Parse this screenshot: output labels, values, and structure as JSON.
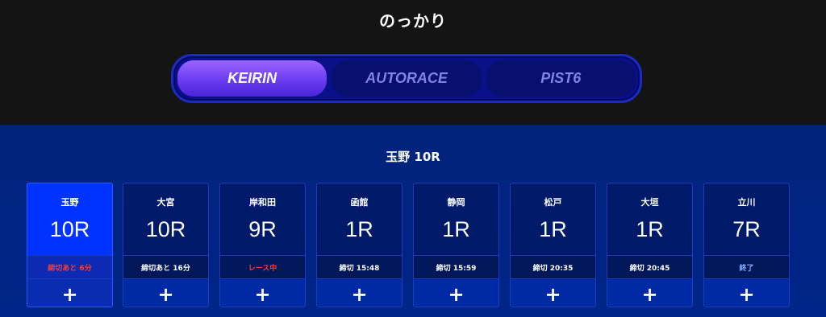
{
  "header": {
    "title": "のっかり"
  },
  "tabs": [
    {
      "label": "KEIRIN",
      "active": true
    },
    {
      "label": "AUTORACE",
      "active": false
    },
    {
      "label": "PIST6",
      "active": false
    }
  ],
  "race_title": "玉野 10R",
  "cards": [
    {
      "venue": "玉野",
      "race": "10R",
      "status": "締切あと 6分",
      "status_color": "red",
      "add": "+"
    },
    {
      "venue": "大宮",
      "race": "10R",
      "status": "締切あと 16分",
      "status_color": "white",
      "add": "+"
    },
    {
      "venue": "岸和田",
      "race": "9R",
      "status": "レース中",
      "status_color": "red",
      "add": "+"
    },
    {
      "venue": "函館",
      "race": "1R",
      "status": "締切 15:48",
      "status_color": "white",
      "add": "+"
    },
    {
      "venue": "静岡",
      "race": "1R",
      "status": "締切 15:59",
      "status_color": "white",
      "add": "+"
    },
    {
      "venue": "松戸",
      "race": "1R",
      "status": "締切 20:35",
      "status_color": "white",
      "add": "+"
    },
    {
      "venue": "大垣",
      "race": "1R",
      "status": "締切 20:45",
      "status_color": "white",
      "add": "+"
    },
    {
      "venue": "立川",
      "race": "7R",
      "status": "終了",
      "status_color": "blue",
      "add": "+"
    }
  ],
  "colors": {
    "accent": "#0033ff",
    "tab_active": "#6a3cf2",
    "background": "#00237a",
    "status_red": "#ff3b30"
  }
}
